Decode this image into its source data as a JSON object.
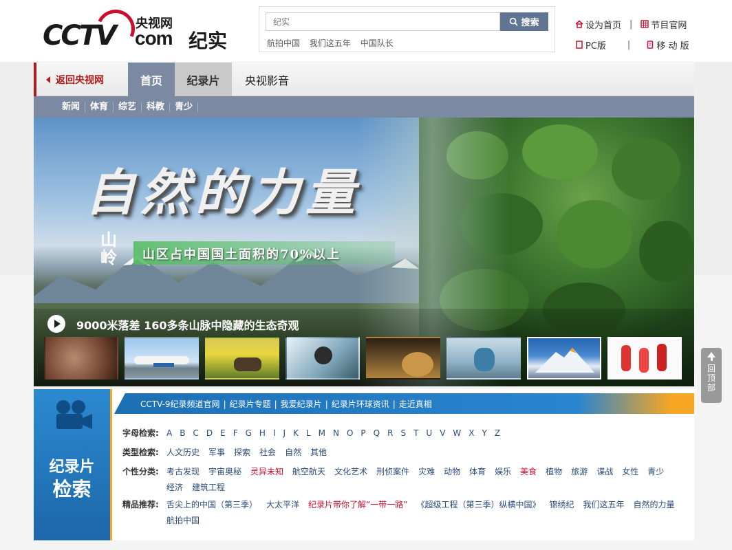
{
  "header": {
    "logo_yangshi": "央视网",
    "logo_cctv": "CCTV",
    "logo_com": "com",
    "logo_channel": "纪实",
    "search": {
      "placeholder": "纪实",
      "button_label": "搜索"
    },
    "hot_links": [
      "航拍中国",
      "我们这五年",
      "中国队长"
    ],
    "quick_links": {
      "set_home": "设为首页",
      "program_site": "节目官网",
      "pc": "PC版",
      "mobile": "移 动 版",
      "separator": "|"
    }
  },
  "nav": {
    "back_label": "返回央视网",
    "tabs": [
      "首页",
      "纪录片",
      "央视影音"
    ],
    "subnav": [
      "新闻",
      "体育",
      "综艺",
      "科教",
      "青少"
    ]
  },
  "hero": {
    "title": "自然的力量",
    "vertical_text": "山岭",
    "subtitle": "山区占中国国土面积的70%以上",
    "caption": "9000米落差 160多条山脉中隐藏的生态奇观"
  },
  "panel": {
    "title_small": "纪录片",
    "title_big": "检索",
    "top_links": [
      "CCTV-9纪录频道官网",
      "纪录片专题",
      "我爱纪录片",
      "纪录片环球资讯",
      "走近真相"
    ],
    "rows": {
      "letters_label": "字母检索:",
      "letters": [
        "A",
        "B",
        "C",
        "D",
        "E",
        "F",
        "G",
        "H",
        "I",
        "J",
        "K",
        "L",
        "M",
        "N",
        "O",
        "P",
        "Q",
        "R",
        "S",
        "T",
        "U",
        "V",
        "W",
        "X",
        "Y",
        "Z"
      ],
      "type_label": "类型检索:",
      "types": [
        "人文历史",
        "军事",
        "探索",
        "社会",
        "自然",
        "其他"
      ],
      "personal_label": "个性分类:",
      "personal": [
        "考古发现",
        "宇宙奥秘",
        "灵异未知",
        "航空航天",
        "文化艺术",
        "刑侦案件",
        "灾难",
        "动物",
        "体育",
        "娱乐",
        "美食",
        "植物",
        "旅游",
        "谍战",
        "女性",
        "青少",
        "经济",
        "建筑工程"
      ],
      "personal_red": [
        "灵异未知",
        "美食"
      ],
      "featured_label": "精品推荐:",
      "featured": [
        "舌尖上的中国（第三季）",
        "大太平洋",
        "纪录片带你了解“一带一路”",
        "《超级工程（第三季）纵横中国》",
        "锦绣纪",
        "我们这五年",
        "自然的力量",
        "航拍中国"
      ],
      "featured_red": [
        "纪录片带你了解“一带一路”"
      ]
    }
  },
  "backtop": {
    "label": "回顶部"
  },
  "colors": {
    "brand_red": "#c8102e",
    "nav_blue": "#7b8aa2",
    "panel_blue": "#1d6fb4",
    "accent_orange": "#f5a623"
  }
}
